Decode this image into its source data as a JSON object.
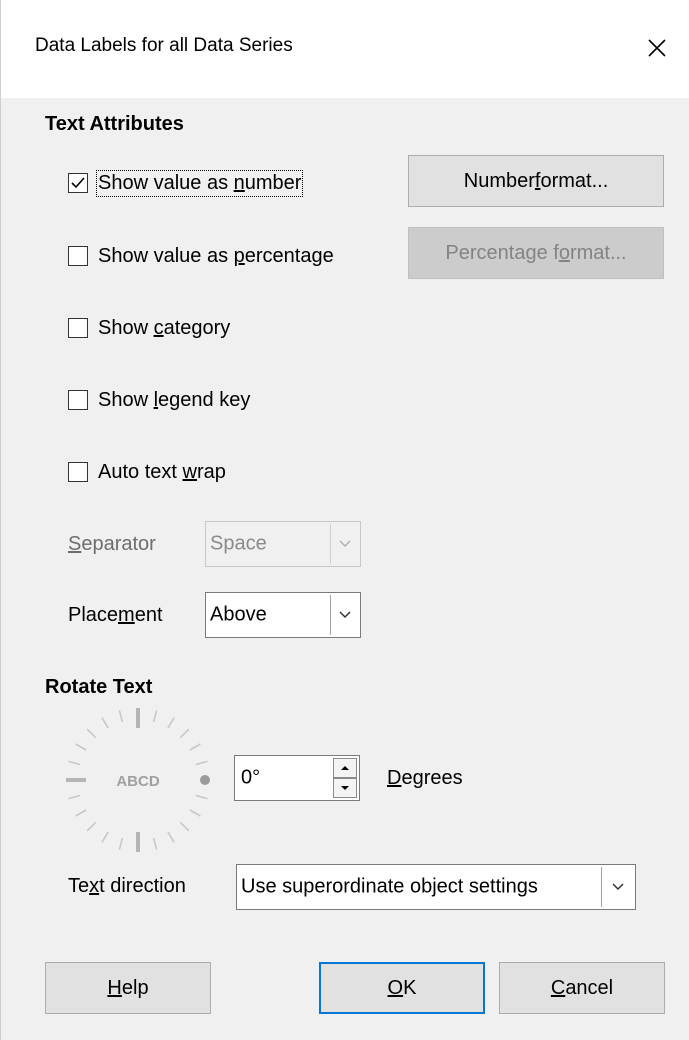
{
  "window": {
    "title": "Data Labels for all Data Series",
    "close_icon": "close-icon"
  },
  "text_attributes": {
    "heading": "Text Attributes",
    "show_value_as_number": {
      "pre": "Show value as ",
      "mn": "n",
      "post": "umber",
      "checked": true
    },
    "show_value_as_percentage": {
      "pre": "Show value as ",
      "mn": "p",
      "post": "ercentage",
      "checked": false
    },
    "show_category": {
      "pre": "Show ",
      "mn": "c",
      "post": "ategory",
      "checked": false
    },
    "show_legend_key": {
      "pre": "Show ",
      "mn": "l",
      "post": "egend key",
      "checked": false
    },
    "auto_text_wrap": {
      "pre": "Auto text ",
      "mn": "w",
      "post": "rap",
      "checked": false
    },
    "number_format_button": {
      "pre": "Number ",
      "mn": "f",
      "post": "ormat..."
    },
    "percentage_format_button": {
      "pre": "Percentage f",
      "mn": "o",
      "post": "rmat..."
    },
    "separator": {
      "mn": "S",
      "post": "eparator",
      "value": "Space"
    },
    "placement": {
      "pre": "Place",
      "mn": "m",
      "post": "ent",
      "value": "Above"
    }
  },
  "rotate_text": {
    "heading": "Rotate Text",
    "dial_label": "ABCD",
    "degrees_value": "0°",
    "degrees_label": {
      "mn": "D",
      "post": "egrees"
    },
    "text_direction_label": {
      "pre": "Te",
      "mn": "x",
      "post": "t direction"
    },
    "text_direction_value": "Use superordinate object settings"
  },
  "buttons": {
    "help": {
      "mn": "H",
      "post": "elp"
    },
    "ok": {
      "mn": "O",
      "post": "K"
    },
    "cancel": {
      "mn": "C",
      "post": "ancel"
    }
  },
  "colors": {
    "dialog_bg": "#f0f0f0",
    "default_button_border": "#0078d7"
  }
}
